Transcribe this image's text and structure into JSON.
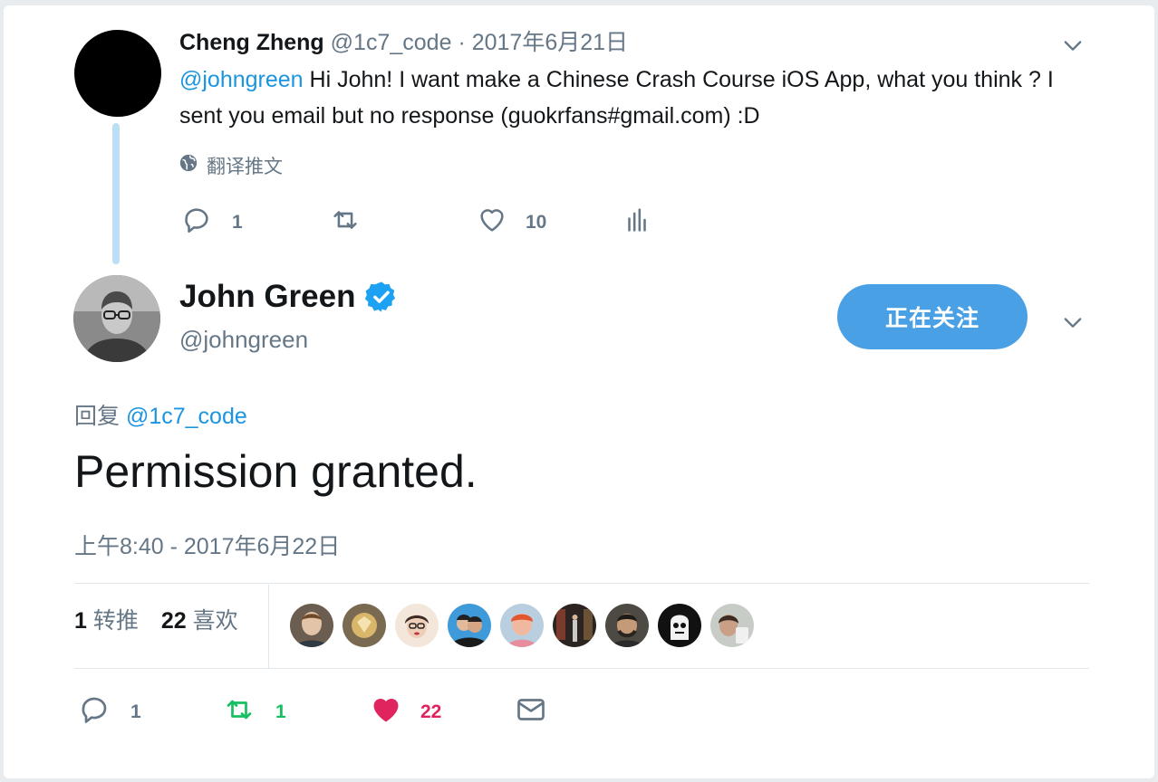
{
  "parent_tweet": {
    "author_name": "Cheng Zheng",
    "handle": "@1c7_code",
    "separator": "·",
    "date": "2017年6月21日",
    "mention": "@johngreen",
    "text": " Hi John! I want make a Chinese Crash Course iOS App, what you think ? I sent you email but no response (guokrfans#gmail.com) :D",
    "translate_label": "翻译推文",
    "actions": {
      "reply_count": "1",
      "retweet_count": "",
      "like_count": "10"
    }
  },
  "main_tweet": {
    "author_name": "John Green",
    "handle": "@johngreen",
    "follow_button_label": "正在关注",
    "reply_prefix": "回复",
    "reply_to": "@1c7_code",
    "text": "Permission granted.",
    "timestamp": "上午8:40 - 2017年6月22日",
    "stats": {
      "retweets_count": "1",
      "retweets_label": "转推",
      "likes_count": "22",
      "likes_label": "喜欢"
    },
    "liker_count": 9,
    "actions": {
      "reply_count": "1",
      "retweet_count": "1",
      "like_count": "22"
    }
  },
  "colors": {
    "link_blue": "#1b95e0",
    "follow_button": "#4aa0e5",
    "retweet_green": "#17bf63",
    "like_red": "#e0245e",
    "muted_gray": "#657786",
    "thread_line": "#bcdff6"
  },
  "icons": {
    "caret": "chevron-down-icon",
    "globe": "globe-icon",
    "reply": "reply-icon",
    "retweet": "retweet-icon",
    "like": "heart-icon",
    "analytics": "analytics-icon",
    "verified": "verified-badge-icon",
    "message": "envelope-icon"
  }
}
